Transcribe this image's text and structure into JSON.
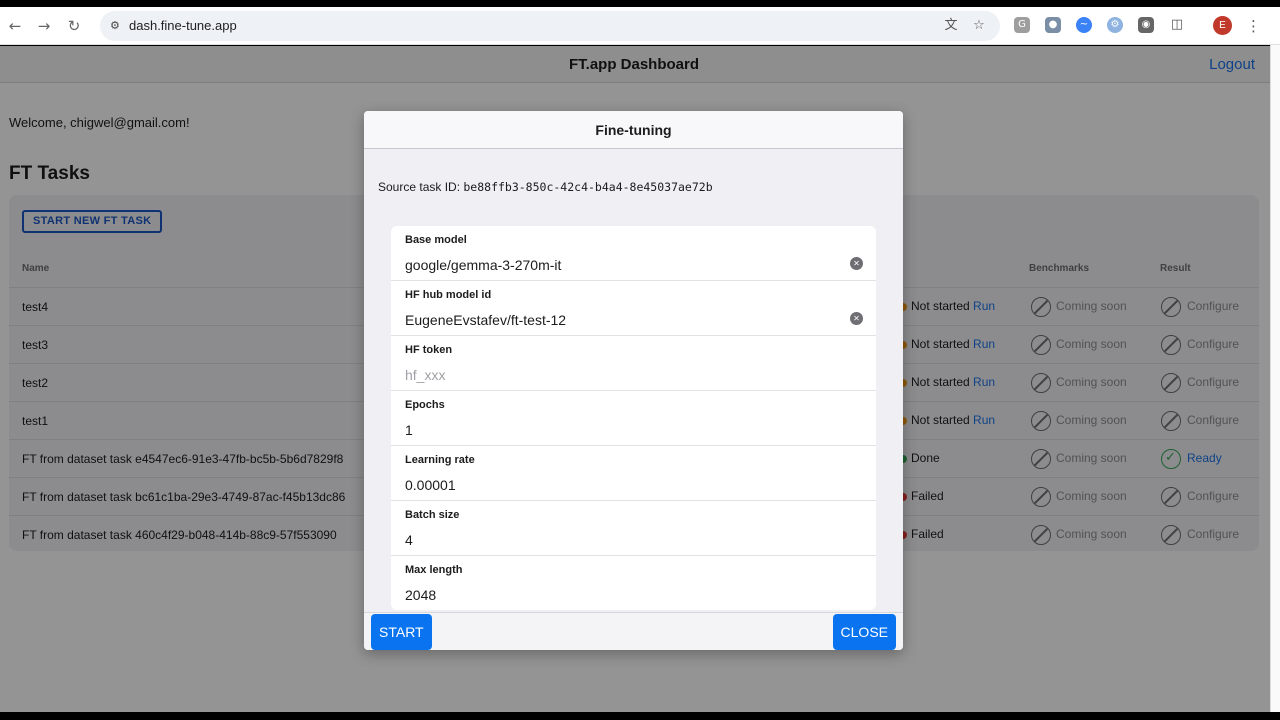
{
  "browser": {
    "url": "dash.fine-tune.app",
    "avatar_letter": "E",
    "icons": [
      "back-icon",
      "forward-icon",
      "reload-icon",
      "site-settings-icon",
      "translate-icon",
      "bookmark-star-icon",
      "extensions-icon",
      "menu-kebab-icon"
    ]
  },
  "app": {
    "title": "FT.app Dashboard",
    "logout": "Logout",
    "welcome": "Welcome, chigwel@gmail.com!",
    "section_title": "FT Tasks",
    "new_task_button": "START NEW FT TASK",
    "columns": {
      "name": "Name",
      "benchmarks": "Benchmarks",
      "result": "Result"
    },
    "tasks": [
      {
        "name": "test4",
        "status": "Not started",
        "action": "Run",
        "benchmarks": "Coming soon",
        "result": "Configure",
        "status_color": "#f39c12"
      },
      {
        "name": "test3",
        "status": "Not started",
        "action": "Run",
        "benchmarks": "Coming soon",
        "result": "Configure",
        "status_color": "#f39c12"
      },
      {
        "name": "test2",
        "status": "Not started",
        "action": "Run",
        "benchmarks": "Coming soon",
        "result": "Configure",
        "status_color": "#f39c12"
      },
      {
        "name": "test1",
        "status": "Not started",
        "action": "Run",
        "benchmarks": "Coming soon",
        "result": "Configure",
        "status_color": "#f39c12"
      },
      {
        "name": "FT from dataset task e4547ec6-91e3-47fb-bc5b-5b6d7829f8",
        "status": "Done",
        "action": "",
        "benchmarks": "Coming soon",
        "result": "Ready",
        "status_color": "#34a853"
      },
      {
        "name": "FT from dataset task bc61c1ba-29e3-4749-87ac-f45b13dc86",
        "status": "Failed",
        "action": "",
        "benchmarks": "Coming soon",
        "result": "Configure",
        "status_color": "#e53935"
      },
      {
        "name": "FT from dataset task 460c4f29-b048-414b-88c9-57f553090",
        "status": "Failed",
        "action": "",
        "benchmarks": "Coming soon",
        "result": "Configure",
        "status_color": "#e53935"
      }
    ]
  },
  "modal": {
    "title": "Fine-tuning",
    "source_label": "Source task ID:",
    "source_id": "be88ffb3-850c-42c4-b4a4-8e45037ae72b",
    "fields": [
      {
        "label": "Base model",
        "value": "google/gemma-3-270m-it",
        "placeholder": "",
        "clearable": true
      },
      {
        "label": "HF hub model id",
        "value": "EugeneEvstafev/ft-test-12",
        "placeholder": "",
        "clearable": true
      },
      {
        "label": "HF token",
        "value": "",
        "placeholder": "hf_xxx",
        "clearable": false
      },
      {
        "label": "Epochs",
        "value": "1",
        "placeholder": "",
        "clearable": false
      },
      {
        "label": "Learning rate",
        "value": "0.00001",
        "placeholder": "",
        "clearable": false
      },
      {
        "label": "Batch size",
        "value": "4",
        "placeholder": "",
        "clearable": false
      },
      {
        "label": "Max length",
        "value": "2048",
        "placeholder": "",
        "clearable": false
      }
    ],
    "start_button": "START",
    "close_button": "CLOSE"
  }
}
